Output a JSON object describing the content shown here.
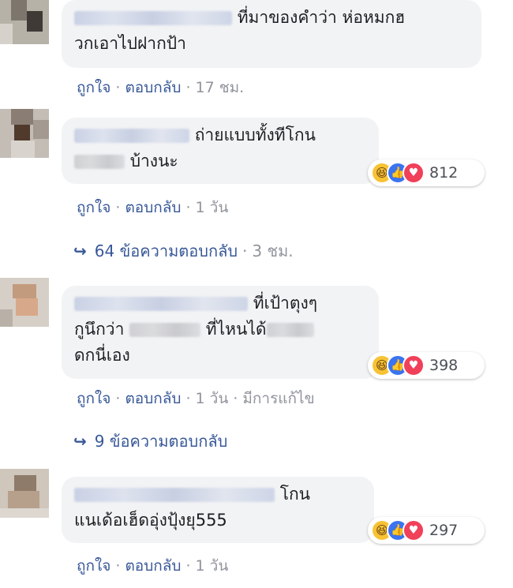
{
  "comments": [
    {
      "name": "",
      "text_line1": "ที่มาของคำว่า ห่อหมกฮ",
      "text_line2": "วกเอาไปฝากป้า",
      "like": "ถูกใจ",
      "reply": "ตอบกลับ",
      "time": "17 ชม."
    },
    {
      "text_line1": "ถ่ายแบบทั้งทีโกน",
      "text_line2": "บ้างนะ",
      "like": "ถูกใจ",
      "reply": "ตอบกลับ",
      "time": "1 วัน",
      "reaction_count": "812",
      "replies_text": "64 ข้อความตอบกลับ",
      "replies_time": "3 ชม."
    },
    {
      "text_line1": "ที่เป้าตุงๆ",
      "text_line2a": "กูนึกว่า",
      "text_line2b": "ที่ไหนได้",
      "text_line3": "ดกนี่เอง",
      "like": "ถูกใจ",
      "reply": "ตอบกลับ",
      "time": "1 วัน",
      "edited": "มีการแก้ไข",
      "reaction_count": "398",
      "replies_text": "9 ข้อความตอบกลับ"
    },
    {
      "text_line1": "โกน",
      "text_line2": "แนเด้อเฮ็ดอุ่งปุ้งยุ555",
      "like": "ถูกใจ",
      "reply": "ตอบกลับ",
      "time": "1 วัน",
      "reaction_count": "297"
    }
  ],
  "separator": "·",
  "reply_arrow": "↪",
  "icons": [
    "haha-reaction-icon",
    "like-reaction-icon",
    "love-reaction-icon",
    "reply-arrow-icon"
  ],
  "colors": {
    "link": "#385898",
    "bubble": "#f2f3f5",
    "meta": "#90949c"
  }
}
